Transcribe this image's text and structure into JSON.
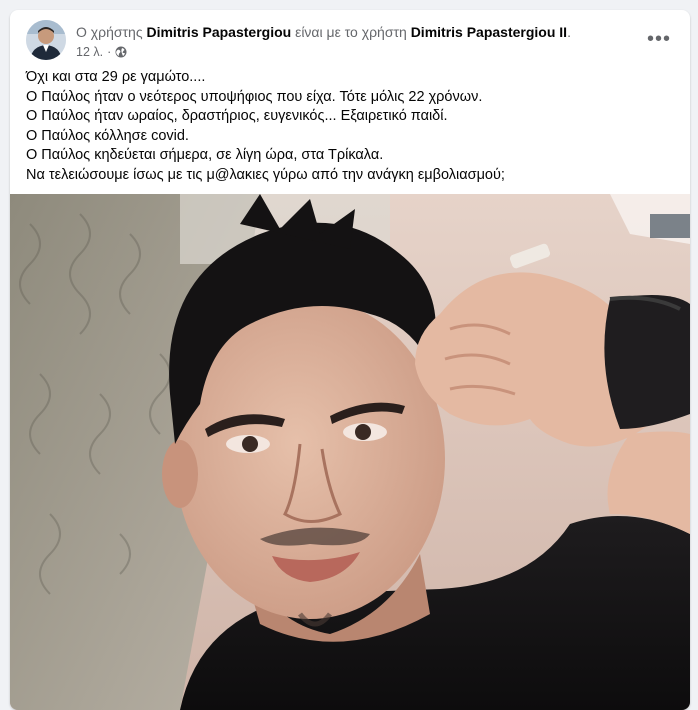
{
  "post": {
    "author_prefix": "Ο χρήστης ",
    "author_name": "Dimitris Papastergiou",
    "with_text": " είναι με το χρήστη ",
    "tagged_name": "Dimitris Papastergiou II",
    "tagged_suffix": ".",
    "time": "12 λ.",
    "dot": "·",
    "audience_icon": "globe-icon",
    "more_icon": "more-options-icon",
    "more_label": "•••",
    "lines": [
      "Όχι και στα 29 ρε γαμώτο....",
      "Ο Παύλος ήταν ο νεότερος υποψήφιος που είχα. Τότε μόλις 22 χρόνων.",
      "Ο Παύλος ήταν ωραίος, δραστήριος, ευγενικός... Εξαιρετικό παιδί.",
      "Ο Παύλος κόλλησε covid.",
      "Ο Παύλος κηδεύεται σήμερα, σε λίγη ώρα, στα Τρίκαλα.",
      "Να τελειώσουμε ίσως με τις μ@λακιες γύρω από την ανάγκη εμβολιασμού;"
    ]
  },
  "colors": {
    "page_bg": "#f0f2f5",
    "card_bg": "#ffffff",
    "secondary_text": "#65676b",
    "primary_text": "#050505"
  }
}
